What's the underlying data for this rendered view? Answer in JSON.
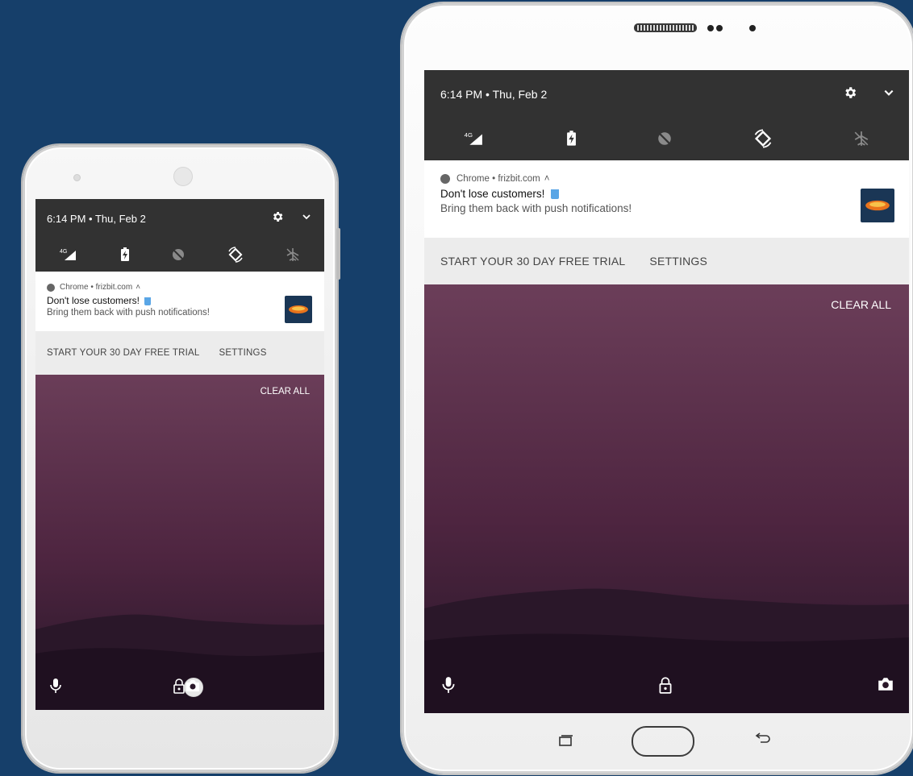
{
  "time_date": "6:14 PM • Thu, Feb 2",
  "network_label": "4G",
  "notification": {
    "source": "Chrome • frizbit.com",
    "title": "Don't lose customers!",
    "body": "Bring them back with push notifications!",
    "thumbnail_icon": "frisbee-logo"
  },
  "actions": {
    "primary": "START YOUR 30 DAY FREE TRIAL",
    "secondary": "SETTINGS"
  },
  "clear_all": "CLEAR ALL",
  "colors": {
    "background": "#163f6a",
    "statusbar": "#323232",
    "actions_bg": "#ececec",
    "thumbnail_bg": "#1a3655",
    "frisbee": "#e9731c"
  }
}
